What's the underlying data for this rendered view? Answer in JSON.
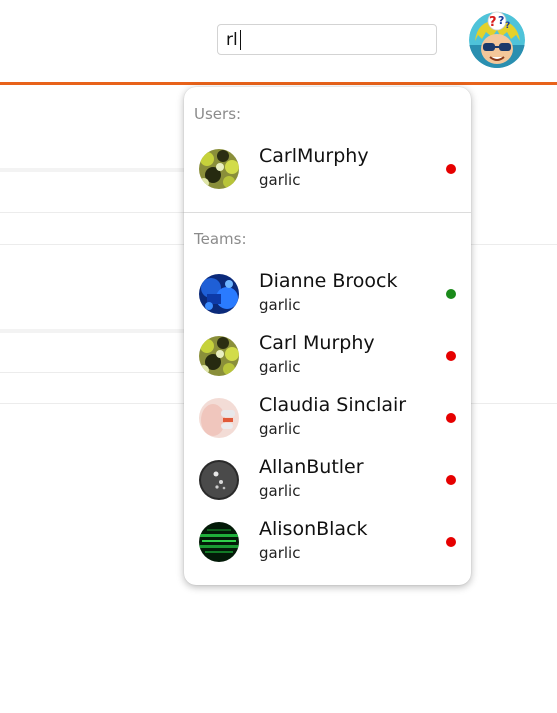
{
  "search": {
    "value": "rl"
  },
  "dropdown": {
    "users_label": "Users:",
    "teams_label": "Teams:",
    "users": [
      {
        "name": "CarlMurphy",
        "sub": "garlic",
        "status": "offline",
        "status_color": "#e60000",
        "avatar": "green-spots-avatar"
      }
    ],
    "teams": [
      {
        "name": "Dianne Broock",
        "sub": "garlic",
        "status": "online",
        "status_color": "#1a8a1a",
        "avatar": "blue-tech-avatar"
      },
      {
        "name": "Carl Murphy",
        "sub": "garlic",
        "status": "offline",
        "status_color": "#e60000",
        "avatar": "green-spots-avatar"
      },
      {
        "name": "Claudia Sinclair",
        "sub": "garlic",
        "status": "offline",
        "status_color": "#e60000",
        "avatar": "pink-hand-avatar"
      },
      {
        "name": "AllanButler",
        "sub": "garlic",
        "status": "offline",
        "status_color": "#e60000",
        "avatar": "dark-bubbles-avatar"
      },
      {
        "name": "AlisonBlack",
        "sub": "garlic",
        "status": "offline",
        "status_color": "#e60000",
        "avatar": "green-code-avatar"
      }
    ]
  },
  "colors": {
    "accent": "#e8621a",
    "online": "#1a8a1a",
    "offline": "#e60000"
  }
}
